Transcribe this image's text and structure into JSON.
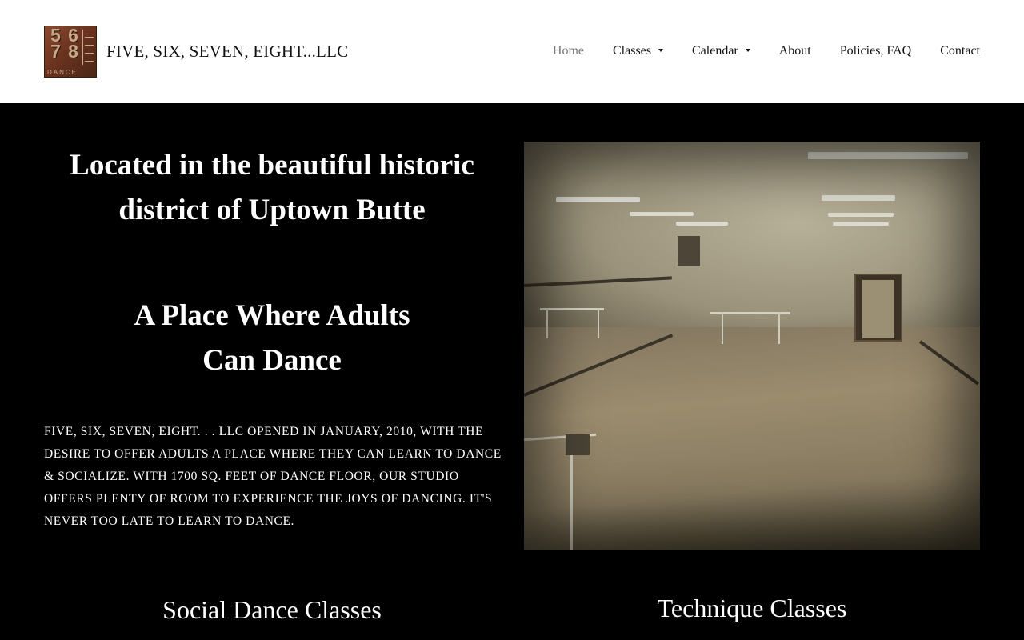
{
  "header": {
    "logo": {
      "digits": [
        "5",
        "6",
        "7",
        "8"
      ],
      "word": "DANCE"
    },
    "site_title": "FIVE, SIX, SEVEN, EIGHT...LLC",
    "nav": [
      {
        "label": "Home",
        "active": true,
        "dropdown": false
      },
      {
        "label": "Classes",
        "active": false,
        "dropdown": true
      },
      {
        "label": "Calendar",
        "active": false,
        "dropdown": true
      },
      {
        "label": "About",
        "active": false,
        "dropdown": false
      },
      {
        "label": "Policies, FAQ",
        "active": false,
        "dropdown": false
      },
      {
        "label": "Contact",
        "active": false,
        "dropdown": false
      }
    ]
  },
  "main": {
    "headline_1": "Located in the beautiful historic district of Uptown Butte",
    "headline_2": "A Place Where Adults Can Dance",
    "intro": "Five, Six, Seven, Eight. . . LLC opened in January, 2010, with the desire to offer adults a place where they can learn to dance & socialize. With 1700 sq. feet of dance floor, our studio offers plenty of room to experience the joys of dancing. It's never too late to learn to dance.",
    "sections": [
      {
        "title": "Social Dance Classes"
      },
      {
        "title": "Technique Classes"
      }
    ]
  },
  "colors": {
    "header_bg": "#ffffff",
    "body_bg": "#000000",
    "nav_active": "#777777",
    "text_dark": "#111111",
    "text_light": "#ffffff"
  }
}
